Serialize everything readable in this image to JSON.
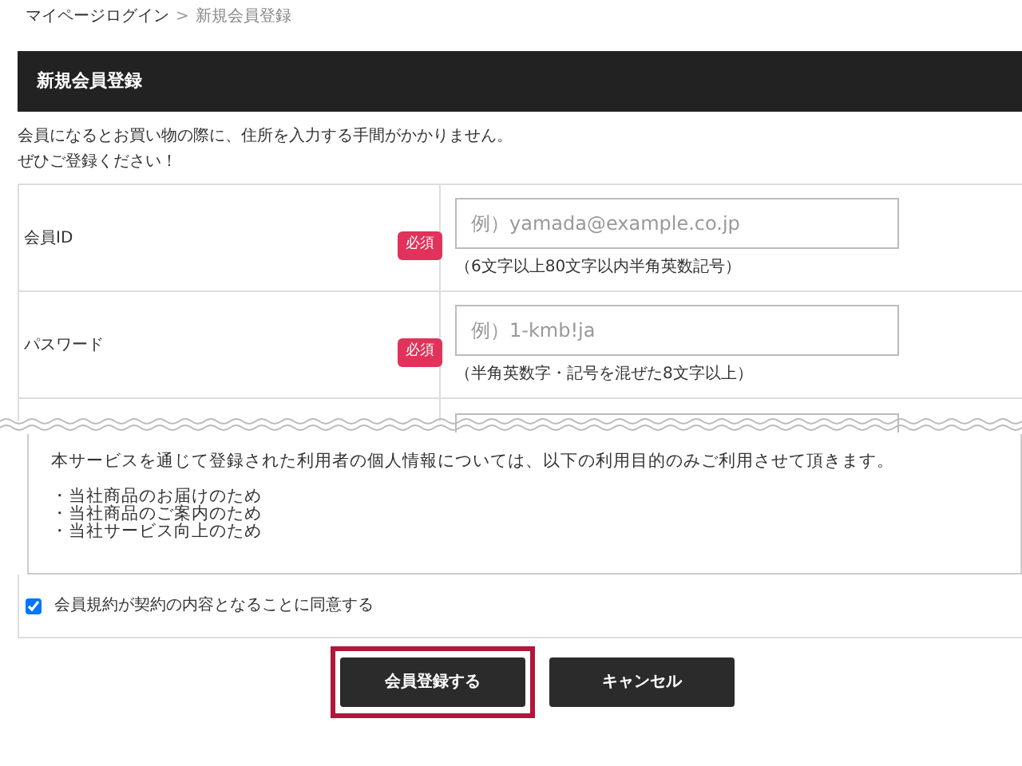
{
  "breadcrumb": [
    {
      "label": "マイページログイン",
      "current": false
    },
    {
      "label": "新規会員登録",
      "current": true
    }
  ],
  "breadcrumb_separator": ">",
  "header": {
    "title": "新規会員登録"
  },
  "intro": [
    "会員になるとお買い物の際に、住所を入力する手間がかかりません。",
    "ぜひご登録ください！"
  ],
  "form_rows": [
    {
      "label": "会員ID",
      "required": true,
      "badge": "必須",
      "placeholder": "例）yamada@example.co.jp",
      "hint": "（6文字以上80文字以内半角英数記号）"
    },
    {
      "label": "パスワード",
      "required": true,
      "badge": "必須",
      "placeholder": "例）1-kmb!ja",
      "hint": "（半角英数字・記号を混ぜた8文字以上）"
    }
  ],
  "policy": {
    "text": "本サービスを通じて登録された利用者の個人情報については、以下の利用目的のみご利用させて頂きます。",
    "items": [
      "・当社商品のお届けのため",
      "・当社商品のご案内のため",
      "・当社サービス向上のため"
    ]
  },
  "agree": {
    "label": "会員規約が契約の内容となることに同意する",
    "checked": true
  },
  "buttons": [
    {
      "label": "会員登録する",
      "highlighted": true
    },
    {
      "label": "キャンセル",
      "highlighted": false
    }
  ]
}
